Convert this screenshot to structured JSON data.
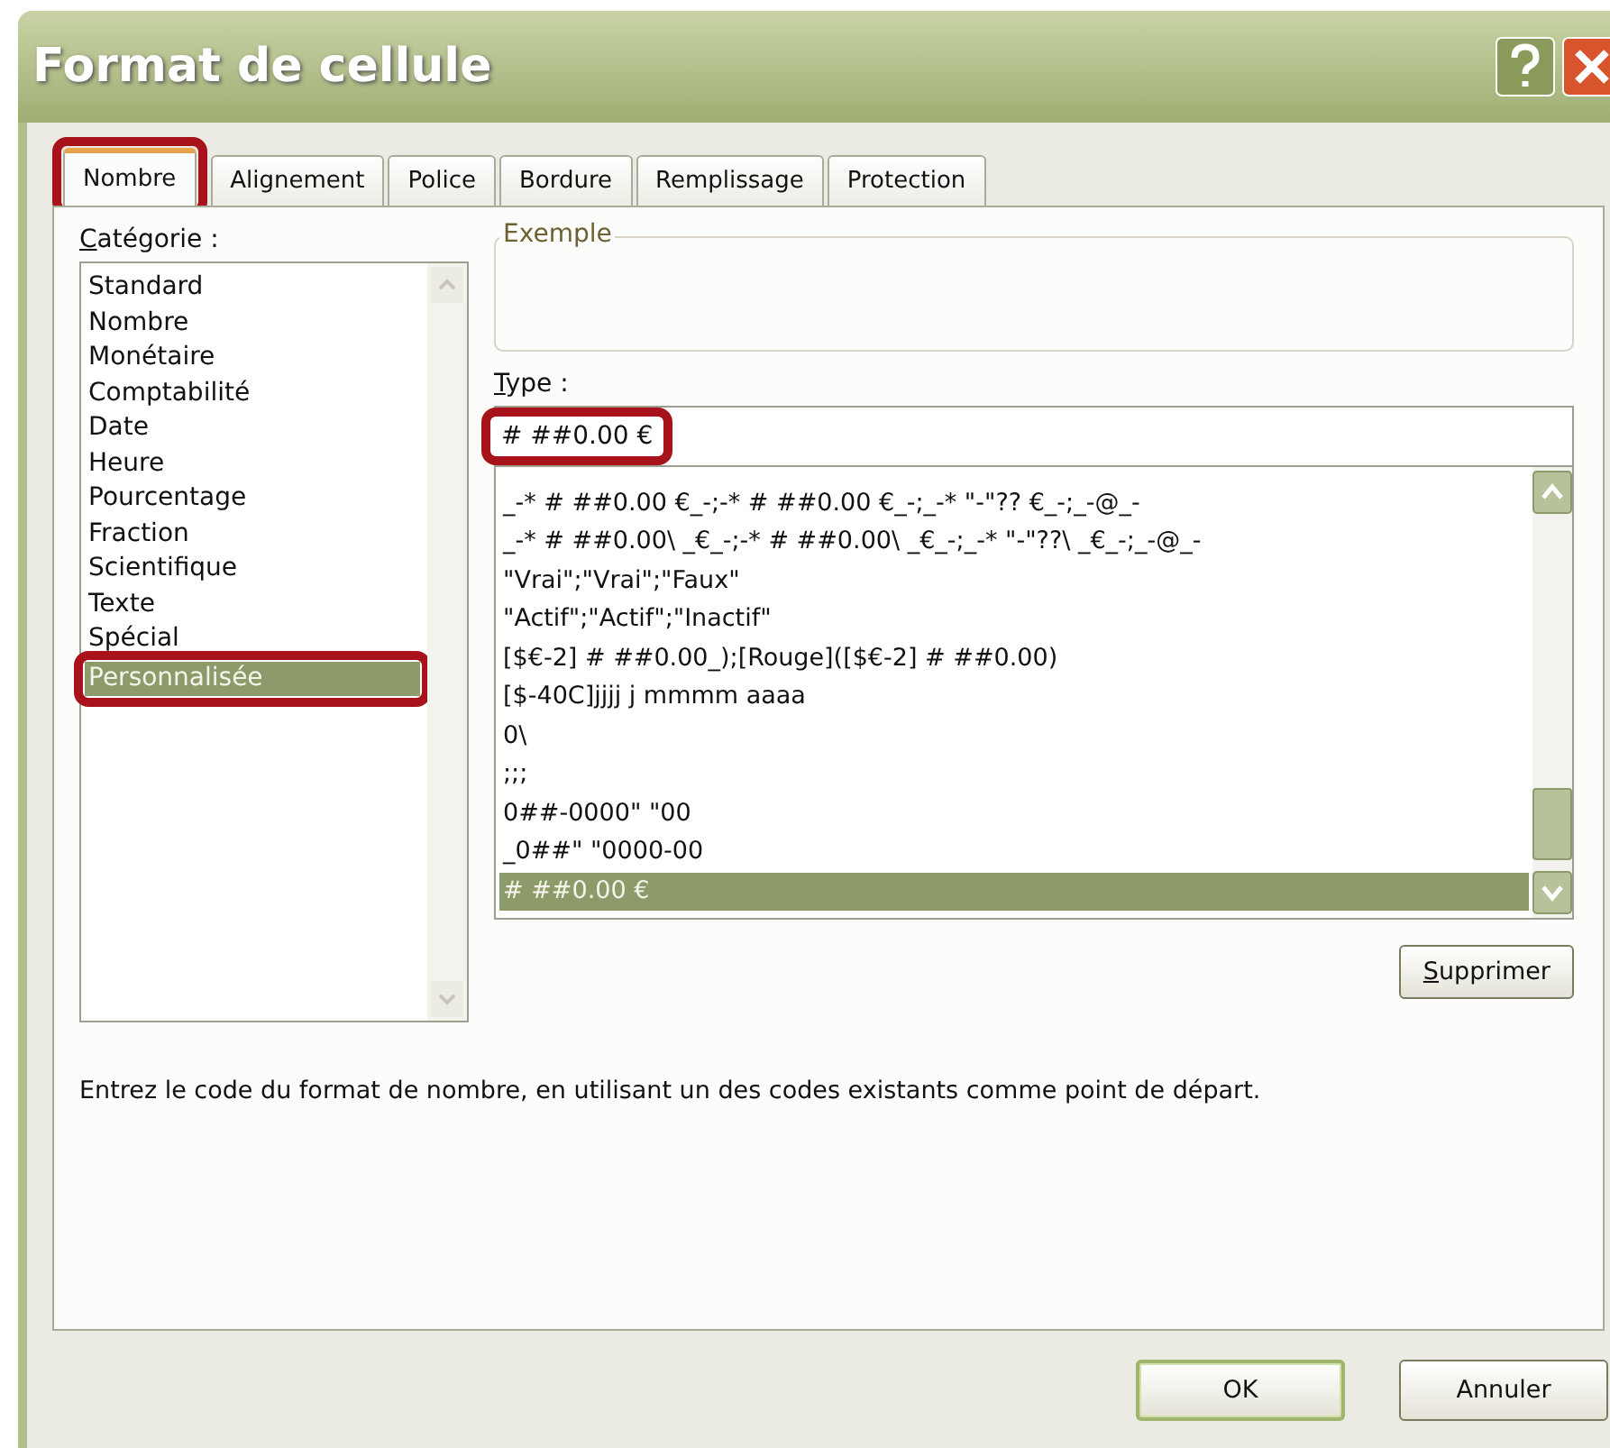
{
  "window": {
    "title": "Format de cellule"
  },
  "tabs": [
    {
      "label": "Nombre",
      "selected": true,
      "highlighted": true
    },
    {
      "label": "Alignement",
      "selected": false,
      "highlighted": false
    },
    {
      "label": "Police",
      "selected": false,
      "highlighted": false
    },
    {
      "label": "Bordure",
      "selected": false,
      "highlighted": false
    },
    {
      "label": "Remplissage",
      "selected": false,
      "highlighted": false
    },
    {
      "label": "Protection",
      "selected": false,
      "highlighted": false
    }
  ],
  "category": {
    "label": "Catégorie :",
    "items": [
      {
        "label": "Standard",
        "selected": false,
        "highlighted": false
      },
      {
        "label": "Nombre",
        "selected": false,
        "highlighted": false
      },
      {
        "label": "Monétaire",
        "selected": false,
        "highlighted": false
      },
      {
        "label": "Comptabilité",
        "selected": false,
        "highlighted": false
      },
      {
        "label": "Date",
        "selected": false,
        "highlighted": false
      },
      {
        "label": "Heure",
        "selected": false,
        "highlighted": false
      },
      {
        "label": "Pourcentage",
        "selected": false,
        "highlighted": false
      },
      {
        "label": "Fraction",
        "selected": false,
        "highlighted": false
      },
      {
        "label": "Scientifique",
        "selected": false,
        "highlighted": false
      },
      {
        "label": "Texte",
        "selected": false,
        "highlighted": false
      },
      {
        "label": "Spécial",
        "selected": false,
        "highlighted": false
      },
      {
        "label": "Personnalisée",
        "selected": true,
        "highlighted": true
      }
    ]
  },
  "example": {
    "label": "Exemple"
  },
  "type": {
    "label": "Type :",
    "value": "# ##0.00 €",
    "highlighted": true
  },
  "formats": [
    {
      "label": "_-* # ##0.00 €_-;-* # ##0.00 €_-;_-* \"-\"?? €_-;_-@_-",
      "selected": false
    },
    {
      "label": "_-* # ##0.00\\ _€_-;-* # ##0.00\\ _€_-;_-* \"-\"??\\ _€_-;_-@_-",
      "selected": false
    },
    {
      "label": "\"Vrai\";\"Vrai\";\"Faux\"",
      "selected": false
    },
    {
      "label": "\"Actif\";\"Actif\";\"Inactif\"",
      "selected": false
    },
    {
      "label": "[$€-2] # ##0.00_);[Rouge]([$€-2] # ##0.00)",
      "selected": false
    },
    {
      "label": "[$-40C]jjjj j mmmm aaaa",
      "selected": false
    },
    {
      "label": "0\\",
      "selected": false
    },
    {
      "label": ";;;",
      "selected": false
    },
    {
      "label": "0##-0000\" \"00",
      "selected": false
    },
    {
      "label": "_0##\"   \"0000-00",
      "selected": false
    },
    {
      "label": "# ##0.00 €",
      "selected": true
    }
  ],
  "delete_button": "Supprimer",
  "description": "Entrez le code du format de nombre, en utilisant un des codes existants comme point de départ.",
  "buttons": [
    {
      "label": "OK",
      "default": true
    },
    {
      "label": "Annuler",
      "default": false
    }
  ]
}
